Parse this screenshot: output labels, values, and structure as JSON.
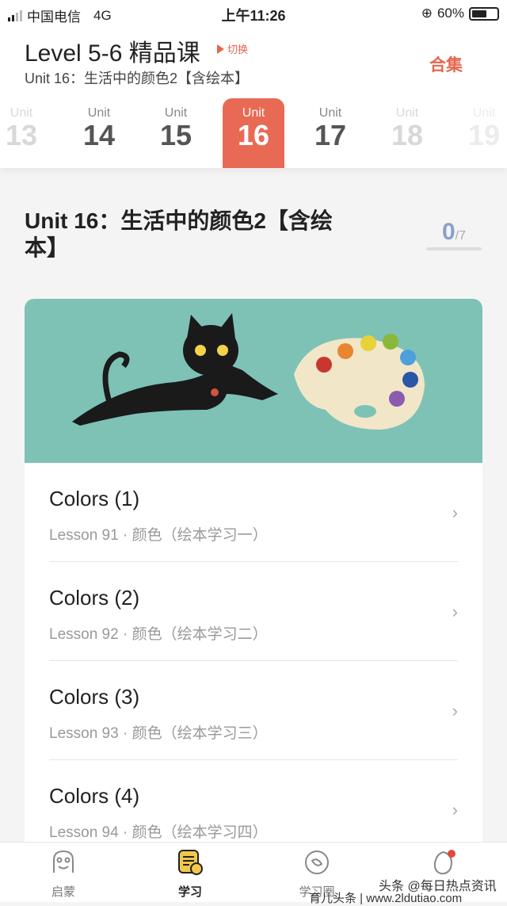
{
  "status_bar": {
    "carrier": "中国电信",
    "network": "4G",
    "time": "上午11:26",
    "battery": "60%",
    "battery_level": 0.6
  },
  "header": {
    "title": "Level 5-6 精品课",
    "switch_label": "切换",
    "subtitle": "Unit 16：生活中的颜色2【含绘本】",
    "collection_label": "合集"
  },
  "units": [
    {
      "label": "Unit",
      "number": "13"
    },
    {
      "label": "Unit",
      "number": "14"
    },
    {
      "label": "Unit",
      "number": "15"
    },
    {
      "label": "Unit",
      "number": "16",
      "active": true
    },
    {
      "label": "Unit",
      "number": "17"
    },
    {
      "label": "Unit",
      "number": "18"
    },
    {
      "label": "Unit",
      "number": "19"
    }
  ],
  "unit_detail": {
    "title": "Unit 16：生活中的颜色2【含绘本】",
    "progress_done": "0",
    "progress_total": "7"
  },
  "lessons": [
    {
      "title": "Colors (1)",
      "subtitle": "Lesson 91 · 颜色（绘本学习一）"
    },
    {
      "title": "Colors (2)",
      "subtitle": "Lesson 92 · 颜色（绘本学习二）"
    },
    {
      "title": "Colors (3)",
      "subtitle": "Lesson 93 · 颜色（绘本学习三）"
    },
    {
      "title": "Colors (4)",
      "subtitle": "Lesson 94 · 颜色（绘本学习四）"
    }
  ],
  "tabs": [
    {
      "label": "启蒙",
      "icon": "ghost-icon"
    },
    {
      "label": "学习",
      "icon": "notes-icon",
      "active": true
    },
    {
      "label": "学习圈",
      "icon": "circle-icon"
    },
    {
      "label": "",
      "icon": "egg-icon",
      "badge": true
    }
  ],
  "watermarks": [
    "头条 @每日热点资讯",
    "育儿头条 | www.2ldutiao.com"
  ],
  "colors": {
    "accent": "#e96a54",
    "banner": "#7ec2b6"
  }
}
